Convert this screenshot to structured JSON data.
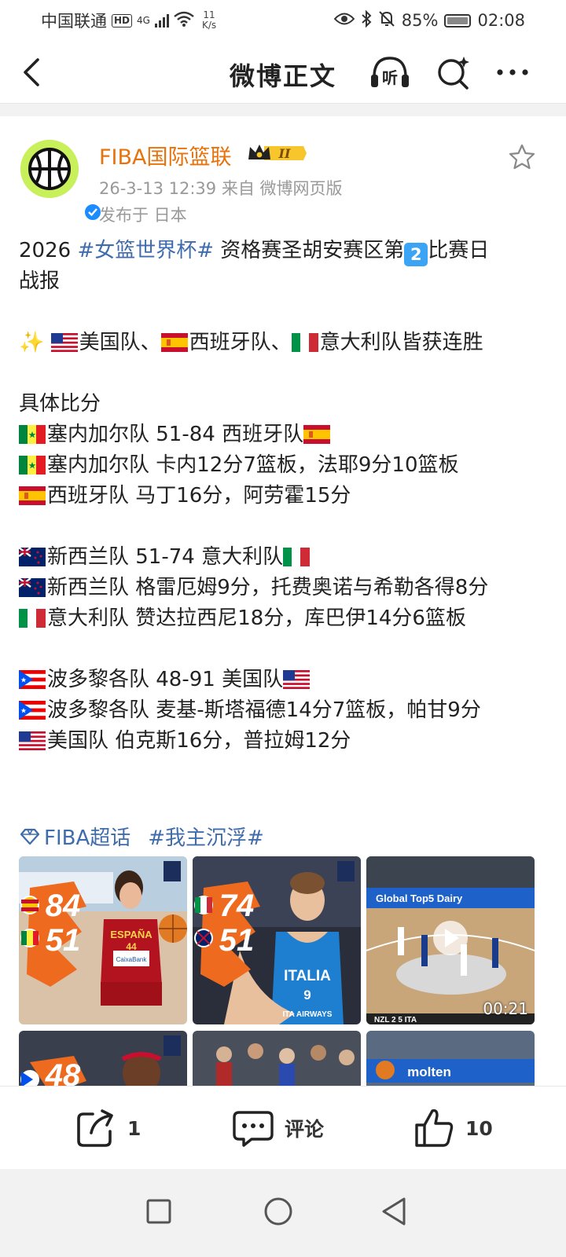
{
  "status_bar": {
    "carrier": "中国联通",
    "hd": "HD",
    "network": "4G",
    "speed_value": "11",
    "speed_unit": "K/s",
    "battery": "85%",
    "time": "02:08"
  },
  "nav": {
    "title": "微博正文",
    "listen_label": "听"
  },
  "post": {
    "author": "FIBA国际篮联",
    "badge_level": "II",
    "meta": "26-3-13 12:39  来自 微博网页版",
    "location": "发布于 日本",
    "lines": {
      "l1_pre": "2026 ",
      "l1_tag": "#女篮世界杯#",
      "l1_mid": " 资格赛圣胡安赛区第",
      "l1_num": "2",
      "l1_post": "比赛日",
      "l2": "战报",
      "l4_sparkle": "✨ ",
      "l4_a": "美国队、",
      "l4_b": "西班牙队、",
      "l4_c": "意大利队皆获连胜",
      "l6": "具体比分",
      "l7_a": "塞内加尔队 51-84 西班牙队",
      "l8": "塞内加尔队 卡内12分7篮板，法耶9分10篮板",
      "l9": "西班牙队 马丁16分，阿劳霍15分",
      "l11": "新西兰队 51-74 意大利队",
      "l12": "新西兰队 格雷厄姆9分，托费奥诺与希勒各得8分",
      "l13": "意大利队 赞达拉西尼18分，库巴伊14分6篮板",
      "l15": "波多黎各队 48-91 美国队",
      "l16": "波多黎各队 麦基-斯塔福德14分7篮板，帕甘9分",
      "l17": "美国队 伯克斯16分，普拉姆12分"
    },
    "topics": [
      "FIBA超话",
      "#我主沉浮#"
    ],
    "photos": [
      {
        "score_top": "84",
        "score_bottom": "51",
        "jersey_team": "ESPAÑA",
        "jersey_number": "44",
        "sponsor": "CaixaBank"
      },
      {
        "score_top": "74",
        "score_bottom": "51",
        "jersey_team": "ITALIA",
        "jersey_number": "9",
        "sponsor": "ITA AIRWAYS"
      },
      {
        "banner": "Global Top5 Dairy",
        "duration": "00:21",
        "scoreboard": "NZL 2 5 ITA"
      },
      {
        "score_top": "48"
      },
      {},
      {
        "banner": "molten"
      }
    ]
  },
  "actions": {
    "repost_count": "1",
    "comment_label": "评论",
    "like_count": "10"
  },
  "colors": {
    "author": "#e8730c",
    "hashtag": "#3f6cad",
    "meta": "#999999",
    "avatar_bg": "#c7f05a",
    "verified": "#1a8cff"
  }
}
